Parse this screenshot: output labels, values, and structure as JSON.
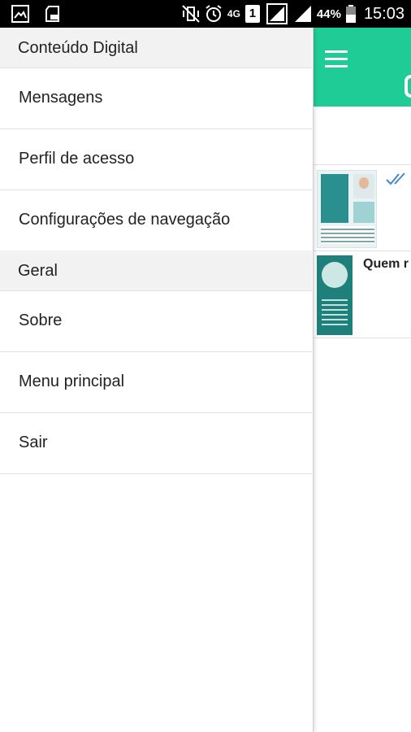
{
  "status_bar": {
    "left_icons": [
      "gallery-icon",
      "sd-card-icon"
    ],
    "right_icons": [
      "vibrate-icon",
      "alarm-icon",
      "4g-icon",
      "sim-1-icon",
      "signal-icon",
      "signal-icon-2",
      "battery-icon"
    ],
    "battery": "44%",
    "time": "15:03",
    "network": "4G",
    "sim": "1"
  },
  "drawer": {
    "sections": [
      {
        "header": "Conteúdo Digital",
        "items": [
          {
            "label": "Mensagens"
          },
          {
            "label": "Perfil de acesso"
          },
          {
            "label": "Configurações de navegação"
          }
        ]
      },
      {
        "header": "Geral",
        "items": [
          {
            "label": "Sobre"
          },
          {
            "label": "Menu principal"
          },
          {
            "label": "Sair"
          }
        ]
      }
    ]
  },
  "background_app": {
    "accent_color": "#20cc96",
    "menu_icon": "hamburger-icon",
    "items": [
      {
        "thumbnail": "document-thumbnail",
        "status_icon": "double-check-icon",
        "title": ""
      },
      {
        "thumbnail": "document-thumbnail",
        "title": "Quem r"
      }
    ]
  }
}
